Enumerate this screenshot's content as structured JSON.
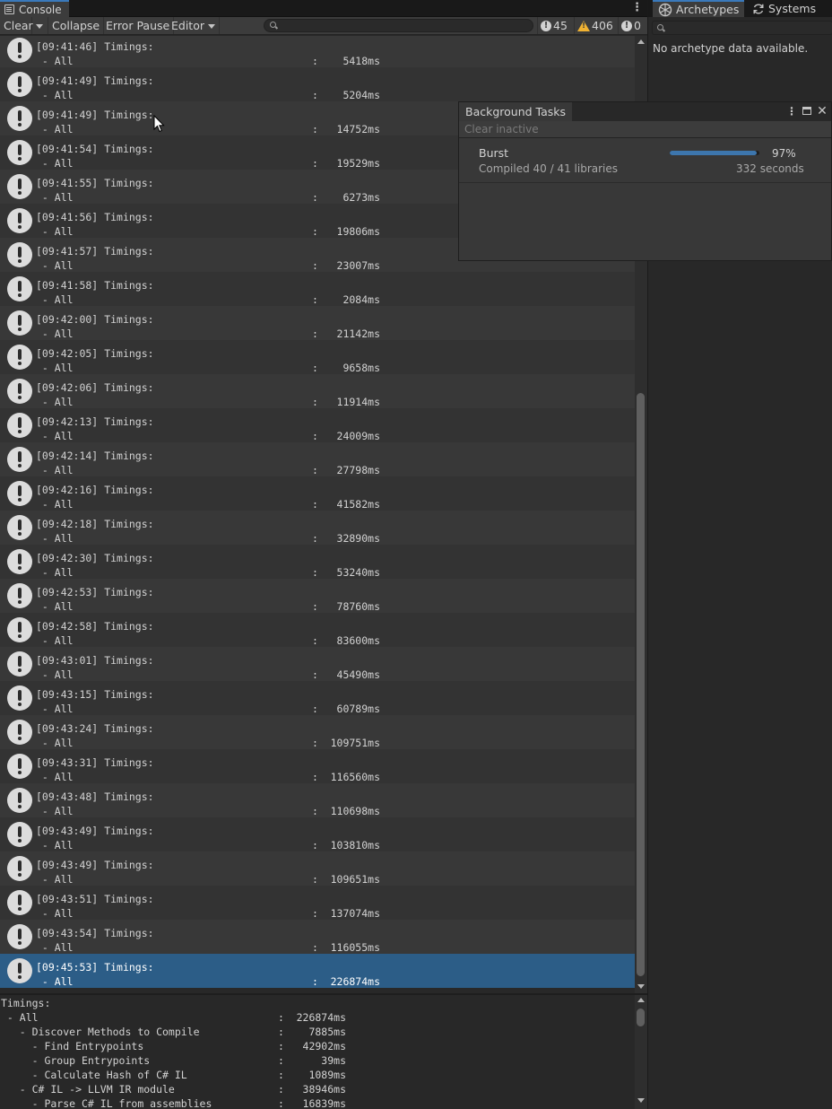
{
  "console": {
    "tab_label": "Console",
    "toolbar": {
      "clear": "Clear",
      "collapse": "Collapse",
      "error_pause": "Error Pause",
      "editor": "Editor",
      "info_count": "45",
      "warning_count": "406",
      "error_count": "0"
    },
    "logs": [
      {
        "time": "[09:41:46]",
        "value": "5418ms"
      },
      {
        "time": "[09:41:49]",
        "value": "5204ms"
      },
      {
        "time": "[09:41:49]",
        "value": "14752ms"
      },
      {
        "time": "[09:41:54]",
        "value": "19529ms"
      },
      {
        "time": "[09:41:55]",
        "value": "6273ms"
      },
      {
        "time": "[09:41:56]",
        "value": "19806ms"
      },
      {
        "time": "[09:41:57]",
        "value": "23007ms"
      },
      {
        "time": "[09:41:58]",
        "value": "2084ms"
      },
      {
        "time": "[09:42:00]",
        "value": "21142ms"
      },
      {
        "time": "[09:42:05]",
        "value": "9658ms"
      },
      {
        "time": "[09:42:06]",
        "value": "11914ms"
      },
      {
        "time": "[09:42:13]",
        "value": "24009ms"
      },
      {
        "time": "[09:42:14]",
        "value": "27798ms"
      },
      {
        "time": "[09:42:16]",
        "value": "41582ms"
      },
      {
        "time": "[09:42:18]",
        "value": "32890ms"
      },
      {
        "time": "[09:42:30]",
        "value": "53240ms"
      },
      {
        "time": "[09:42:53]",
        "value": "78760ms"
      },
      {
        "time": "[09:42:58]",
        "value": "83600ms"
      },
      {
        "time": "[09:43:01]",
        "value": "45490ms"
      },
      {
        "time": "[09:43:15]",
        "value": "60789ms"
      },
      {
        "time": "[09:43:24]",
        "value": "109751ms"
      },
      {
        "time": "[09:43:31]",
        "value": "116560ms"
      },
      {
        "time": "[09:43:48]",
        "value": "110698ms"
      },
      {
        "time": "[09:43:49]",
        "value": "103810ms"
      },
      {
        "time": "[09:43:49]",
        "value": "109651ms"
      },
      {
        "time": "[09:43:51]",
        "value": "137074ms"
      },
      {
        "time": "[09:43:54]",
        "value": "116055ms"
      },
      {
        "time": "[09:45:53]",
        "value": "226874ms",
        "selected": true
      }
    ],
    "log_title": "Timings:",
    "log_item": " - All",
    "detail": [
      {
        "label": "Timings:",
        "value": ""
      },
      {
        "label": " - All",
        "value": "226874ms"
      },
      {
        "label": "   - Discover Methods to Compile",
        "value": "7885ms"
      },
      {
        "label": "     - Find Entrypoints",
        "value": "42902ms"
      },
      {
        "label": "     - Group Entrypoints",
        "value": "39ms"
      },
      {
        "label": "     - Calculate Hash of C# IL",
        "value": "1089ms"
      },
      {
        "label": "   - C# IL -> LLVM IR module",
        "value": "38946ms"
      },
      {
        "label": "     - Parse C# IL from assemblies",
        "value": "16839ms"
      }
    ]
  },
  "right_panel": {
    "tabs": [
      "Archetypes",
      "Systems"
    ],
    "empty_message": "No archetype data available."
  },
  "background_tasks": {
    "title": "Background Tasks",
    "clear_inactive": "Clear inactive",
    "task": {
      "name": "Burst",
      "subtitle": "Compiled 40 / 41 libraries",
      "percent_label": "97%",
      "progress": 0.97,
      "time": "332 seconds"
    }
  },
  "colors": {
    "selection": "#2c5d87",
    "accent": "#3a79bb",
    "warning": "#f0b232",
    "progress": "#3d76ad"
  }
}
